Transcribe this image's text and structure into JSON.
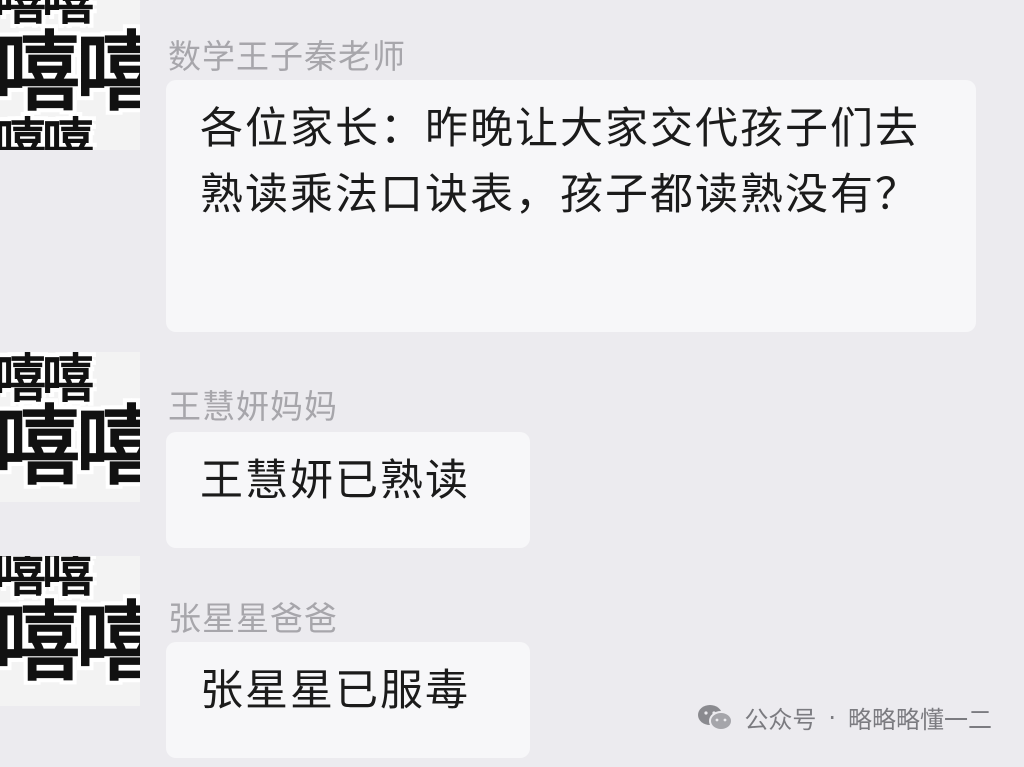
{
  "messages": [
    {
      "avatar": {
        "top_text": "嘻嘻",
        "main_text": "嘻嘻"
      },
      "sender": "数学王子秦老师",
      "text": "各位家长：昨晚让大家交代孩子们去熟读乘法口诀表，孩子都读熟没有？"
    },
    {
      "avatar": {
        "top_text": "嘻嘻",
        "main_text": "嘻嘻"
      },
      "sender": "王慧妍妈妈",
      "text": "王慧妍已熟读"
    },
    {
      "avatar": {
        "top_text": "嘻嘻",
        "main_text": "嘻嘻"
      },
      "sender": "张星星爸爸",
      "text": "张星星已服毒"
    }
  ],
  "watermark": {
    "icon": "wechat-icon",
    "label": "公众号",
    "separator": "·",
    "account": "略略略懂一二"
  }
}
